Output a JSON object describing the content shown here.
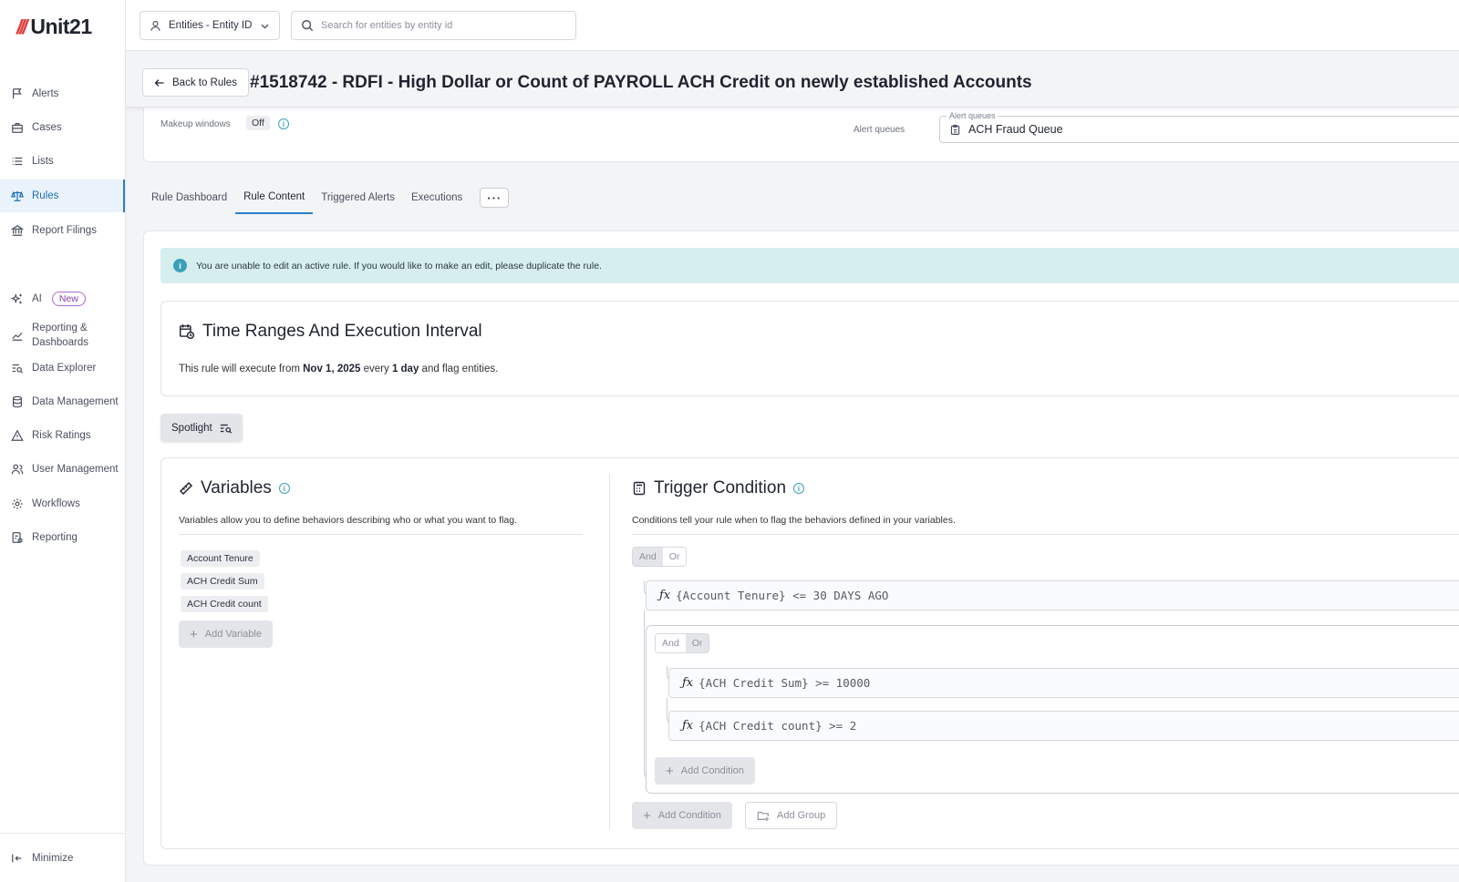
{
  "app": {
    "logo_slashes": "///",
    "logo_text": "Unit21"
  },
  "sidebar": {
    "items": [
      {
        "label": "Alerts"
      },
      {
        "label": "Cases"
      },
      {
        "label": "Lists"
      },
      {
        "label": "Rules"
      },
      {
        "label": "Report Filings"
      },
      {
        "label": "AI",
        "badge": "New"
      },
      {
        "label": "Reporting &",
        "label2": "Dashboards"
      },
      {
        "label": "Data Explorer"
      },
      {
        "label": "Data Management"
      },
      {
        "label": "Risk Ratings"
      },
      {
        "label": "User Management"
      },
      {
        "label": "Workflows"
      },
      {
        "label": "Reporting"
      }
    ],
    "minimize": "Minimize",
    "active_color": "#2a7fd0"
  },
  "topbar": {
    "entity_select": "Entities - Entity ID",
    "search_placeholder": "Search for entities by entity id"
  },
  "header": {
    "back_label": "Back to Rules",
    "title": "#1518742 - RDFI - High Dollar or Count of PAYROLL ACH Credit on newly established Accounts"
  },
  "summary": {
    "makeup_label": "Makeup windows",
    "makeup_value": "Off",
    "alert_queues_label": "Alert queues",
    "alert_queues_legend": "Alert queues",
    "alert_queues_value": "ACH Fraud Queue"
  },
  "tabs": [
    "Rule Dashboard",
    "Rule Content",
    "Triggered Alerts",
    "Executions"
  ],
  "active_tab": "Rule Content",
  "more_label": "···",
  "notice": "You are unable to edit an active rule. If you would like to make an edit, please duplicate the rule.",
  "time": {
    "title": "Time Ranges And Execution Interval",
    "prefix": "This rule will execute from ",
    "start": "Nov 1, 2025",
    "middle": " every ",
    "interval": "1 day",
    "suffix": " and flag entities."
  },
  "spotlight": "Spotlight",
  "variables": {
    "title": "Variables",
    "description": "Variables allow you to define behaviors describing who or what you want to flag.",
    "items": [
      "Account Tenure",
      "ACH Credit Sum",
      "ACH Credit count"
    ],
    "add_label": "Add Variable"
  },
  "trigger": {
    "title": "Trigger Condition",
    "description": "Conditions tell your rule when to flag the behaviors defined in your variables.",
    "outer_and": "And",
    "outer_or": "Or",
    "outer_selected": "And",
    "condition1": "{Account Tenure} <= 30 DAYS AGO",
    "inner_and": "And",
    "inner_or": "Or",
    "inner_selected": "Or",
    "condition2": "{ACH Credit Sum} >= 10000",
    "condition3": "{ACH Credit count} >= 2",
    "inner_add_condition": "Add Condition",
    "add_condition": "Add Condition",
    "add_group": "Add Group"
  }
}
